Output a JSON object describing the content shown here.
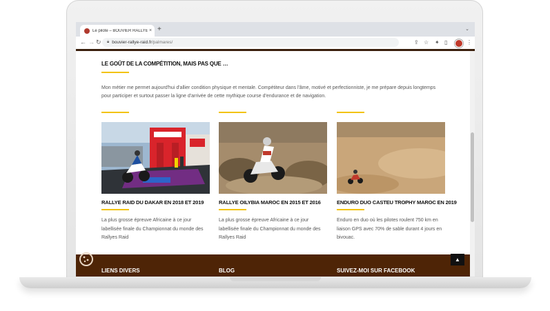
{
  "browser": {
    "tab_title": "Le pilote – BOUVIER RALLYE R",
    "tab_close": "×",
    "new_tab": "+",
    "tab_menu": "⌄",
    "back": "←",
    "forward": "→",
    "reload": "↻",
    "url_host": "bouvier-rallye-raid.fr",
    "url_path": "/palmares/"
  },
  "section": {
    "heading": "LE GOÛT DE LA COMPÉTITION, MAIS PAS QUE …",
    "intro": "Mon métier me permet aujourd'hui d'allier condition physique et mentale. Compétiteur dans l'âme, motivé et perfectionniste, je me prépare depuis longtemps pour participer et surtout passer la ligne d'arrivée de cette mythique course d'endurance et de navigation."
  },
  "cards": [
    {
      "title": "RALLYE RAID DU DAKAR EN 2018 ET 2019",
      "text": "La plus grosse épreuve Africaine à ce jour labellisée finale du Championnat du monde des Rallyes Raid"
    },
    {
      "title": "RALLYE OILYBIA MAROC EN 2015 ET 2016",
      "text": "La plus grosse épreuve Africaine à ce jour labellisée finale du Championnat du monde des Rallyes Raid"
    },
    {
      "title": "ENDURO DUO CASTEU TROPHY MAROC EN 2019",
      "text": "Enduro en duo où les pilotes roulent 750 km en liaison GPS avec 70% de sable durant 4 jours en bivouac."
    }
  ],
  "footer": {
    "col1": "LIENS DIVERS",
    "col2": "BLOG",
    "col3": "SUIVEZ-MOI SUR FACEBOOK",
    "to_top": "▲"
  },
  "colors": {
    "accent_yellow": "#f2c200",
    "footer_brown": "#4e2406"
  }
}
